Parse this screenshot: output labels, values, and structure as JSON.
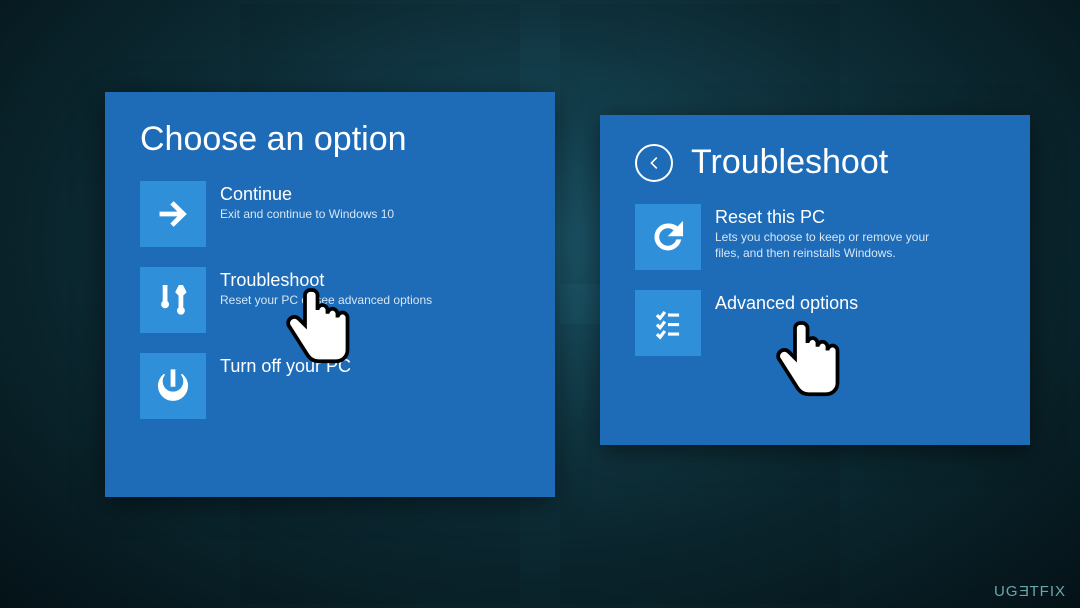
{
  "left_panel": {
    "title": "Choose an option",
    "tiles": [
      {
        "title": "Continue",
        "desc": "Exit and continue to Windows 10"
      },
      {
        "title": "Troubleshoot",
        "desc": "Reset your PC or see advanced options"
      },
      {
        "title": "Turn off your PC",
        "desc": ""
      }
    ]
  },
  "right_panel": {
    "title": "Troubleshoot",
    "tiles": [
      {
        "title": "Reset this PC",
        "desc": "Lets you choose to keep or remove your files, and then reinstalls Windows."
      },
      {
        "title": "Advanced options",
        "desc": ""
      }
    ]
  },
  "watermark": "UGETFIX"
}
